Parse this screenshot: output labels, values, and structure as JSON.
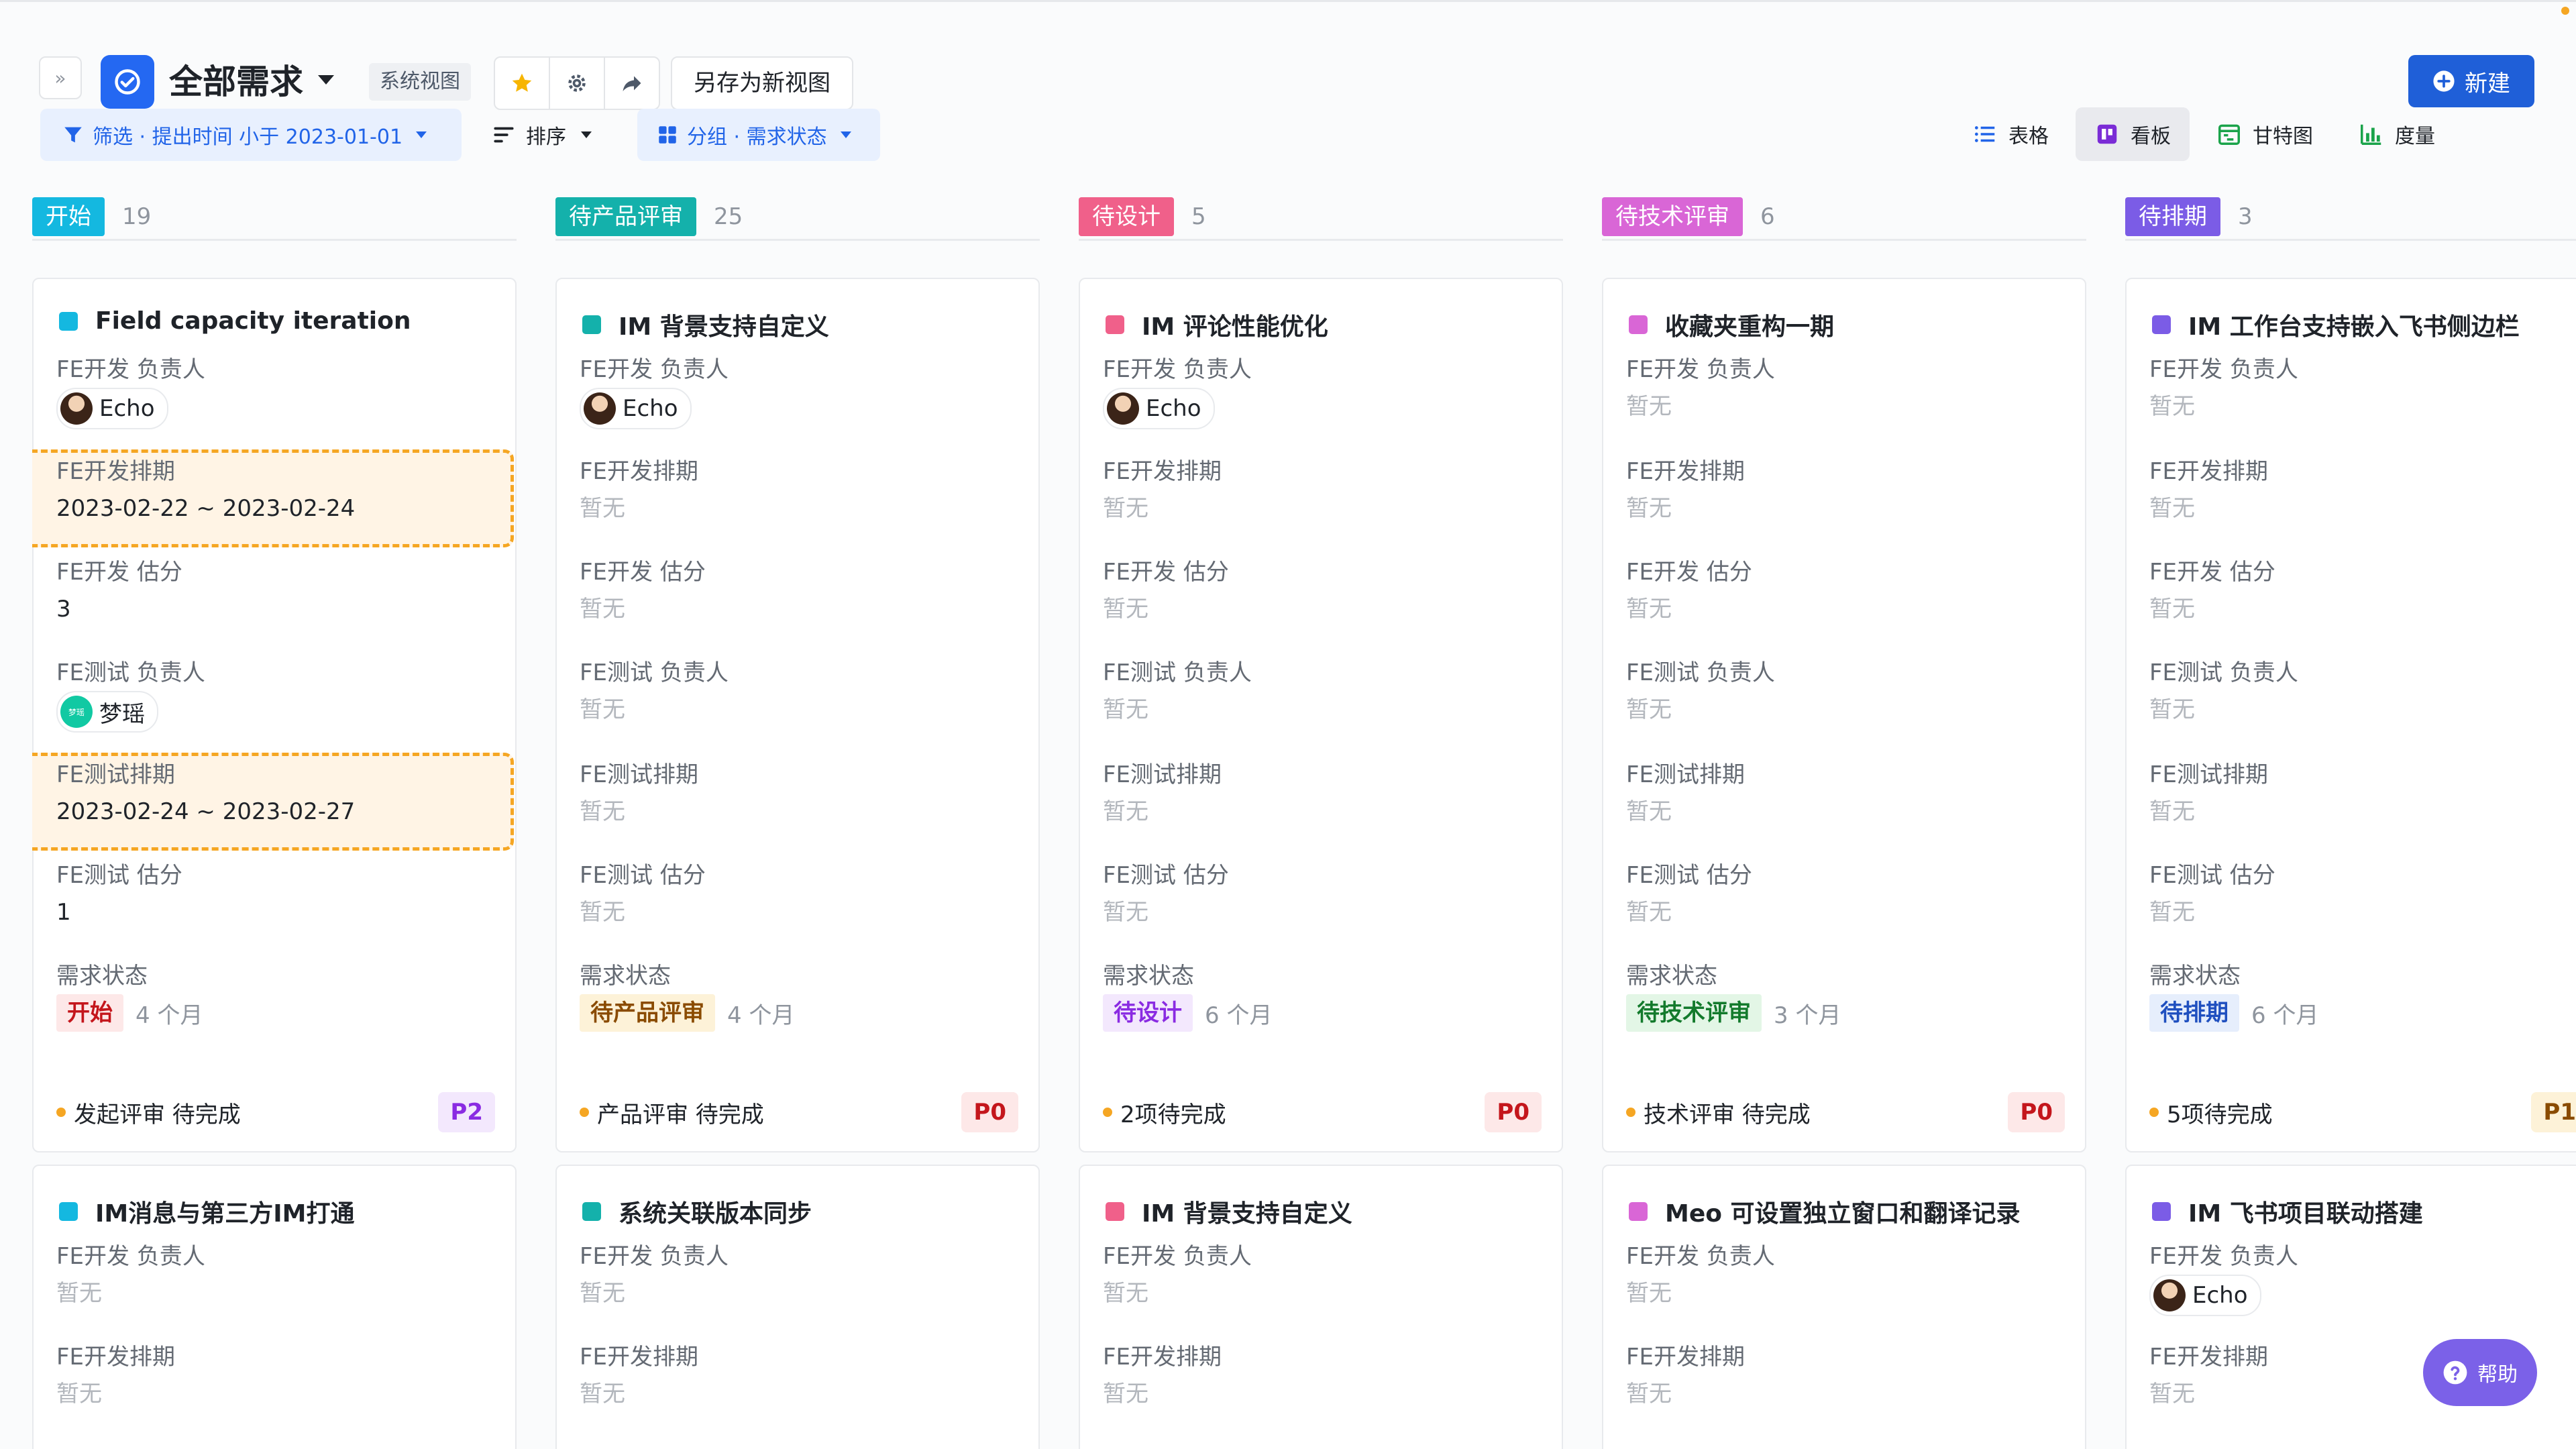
{
  "header": {
    "title": "全部需求",
    "system_view_tag": "系统视图",
    "save_as_label": "另存为新视图",
    "new_label": "新建"
  },
  "toolbar": {
    "filter_label": "筛选 · 提出时间 小于 2023-01-01",
    "sort_label": "排序",
    "group_label": "分组 · 需求状态",
    "views": [
      "表格",
      "看板",
      "甘特图",
      "度量"
    ],
    "active_view": "看板"
  },
  "field_labels": {
    "fe_dev_owner": "FE开发 负责人",
    "fe_dev_schedule": "FE开发排期",
    "fe_dev_estimate": "FE开发 估分",
    "fe_test_owner": "FE测试 负责人",
    "fe_test_schedule": "FE测试排期",
    "fe_test_estimate": "FE测试 估分",
    "status": "需求状态",
    "empty": "暂无"
  },
  "columns": [
    {
      "name": "开始",
      "count": "19",
      "color": "#14b8e0",
      "cards": [
        {
          "title": "Field capacity iteration",
          "color": "#14b8e0",
          "fe_dev_owner": "Echo",
          "fe_dev_schedule": "2023-02-22 ~ 2023-02-24",
          "fe_dev_estimate": "3",
          "fe_test_owner": "梦瑶",
          "fe_test_owner_avatar": "梦瑶",
          "fe_test_schedule": "2023-02-24 ~ 2023-02-27",
          "fe_test_estimate": "1",
          "status": "开始",
          "age": "4 个月",
          "footer": "发起评审 待完成",
          "priority": "P2"
        },
        {
          "title": "IM消息与第三方IM打通",
          "color": "#14b8e0"
        }
      ]
    },
    {
      "name": "待产品评审",
      "count": "25",
      "color": "#14b1ab",
      "cards": [
        {
          "title": "IM 背景支持自定义",
          "color": "#14b1ab",
          "fe_dev_owner": "Echo",
          "status": "待产品评审",
          "age": "4 个月",
          "footer": "产品评审 待完成",
          "priority": "P0"
        },
        {
          "title": "系统关联版本同步",
          "color": "#14b1ab"
        }
      ]
    },
    {
      "name": "待设计",
      "count": "5",
      "color": "#f0608a",
      "cards": [
        {
          "title": "IM 评论性能优化",
          "color": "#f0608a",
          "fe_dev_owner": "Echo",
          "status": "待设计",
          "age": "6 个月",
          "footer": "2项待完成",
          "priority": "P0"
        },
        {
          "title": "IM 背景支持自定义",
          "color": "#f0608a"
        }
      ]
    },
    {
      "name": "待技术评审",
      "count": "6",
      "color": "#d966d6",
      "cards": [
        {
          "title": "收藏夹重构一期",
          "color": "#d966d6",
          "status": "待技术评审",
          "age": "3 个月",
          "footer": "技术评审 待完成",
          "priority": "P0"
        },
        {
          "title": "Meo 可设置独立窗口和翻译记录",
          "color": "#d966d6"
        }
      ]
    },
    {
      "name": "待排期",
      "count": "3",
      "color": "#7b5ce6",
      "cards": [
        {
          "title": "IM 工作台支持嵌入飞书侧边栏",
          "color": "#7b5ce6",
          "status": "待排期",
          "age": "6 个月",
          "footer": "5项待完成",
          "priority": "P1"
        },
        {
          "title": "IM 飞书项目联动搭建",
          "color": "#7b5ce6",
          "fe_dev_owner": "Echo"
        }
      ]
    }
  ],
  "help_label": "帮助"
}
